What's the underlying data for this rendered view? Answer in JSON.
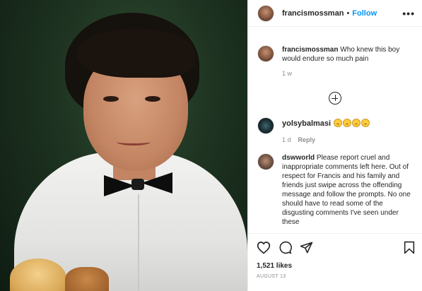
{
  "post": {
    "username": "francismossman",
    "separator": "•",
    "follow_label": "Follow",
    "more_label": "•••"
  },
  "comments": [
    {
      "username": "francismossman",
      "text": "Who knew this boy would endure so much pain",
      "age": "1 w"
    },
    {
      "username": "yolsybalmasi",
      "emoji_count": 4,
      "age": "1 d",
      "reply_label": "Reply"
    },
    {
      "username": "dswworld",
      "text": "Please report cruel and inappropriate comments left here. Out of respect for Francis and his family and friends just swipe across the offending message and follow the prompts. No one should have to read some of the disgusting comments I've seen under these"
    }
  ],
  "actions": {
    "likes": "1,521 likes",
    "date": "AUGUST 13"
  },
  "icons": [
    "heart-icon",
    "comment-icon",
    "share-icon",
    "bookmark-icon",
    "add-comment-icon"
  ],
  "colors": {
    "follow": "#0095f6",
    "text": "#262626",
    "muted": "#8e8e8e"
  }
}
